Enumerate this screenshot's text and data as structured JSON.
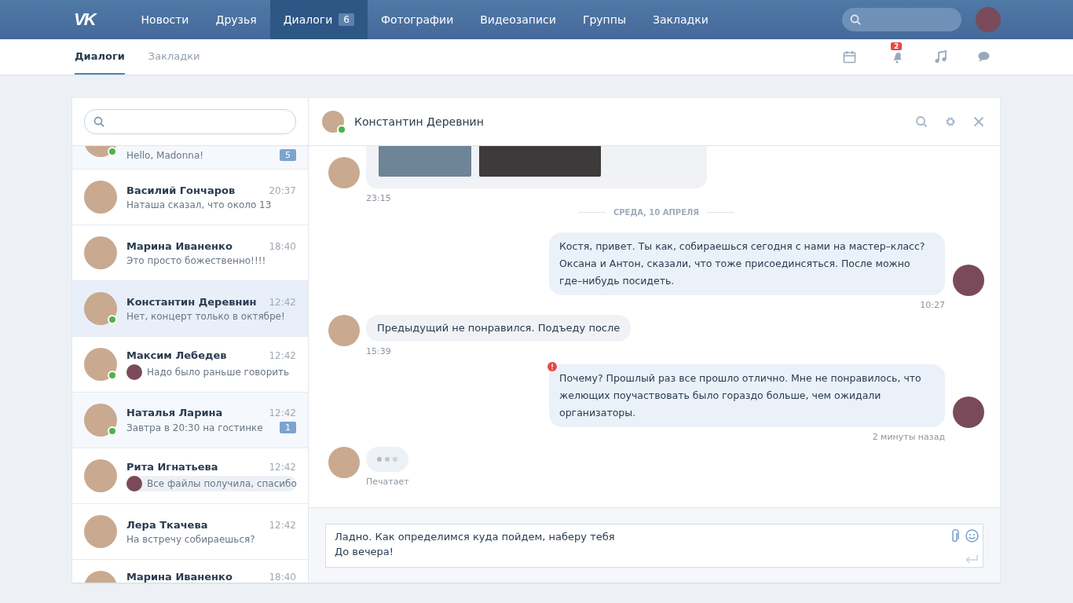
{
  "topbar": {
    "logo": "VK",
    "nav": [
      {
        "label": "Новости",
        "selected": false
      },
      {
        "label": "Друзья",
        "selected": false
      },
      {
        "label": "Диалоги",
        "selected": true,
        "badge": "6"
      },
      {
        "label": "Фотографии",
        "selected": false
      },
      {
        "label": "Видеозаписи",
        "selected": false
      },
      {
        "label": "Группы",
        "selected": false
      },
      {
        "label": "Закладки",
        "selected": false
      }
    ]
  },
  "subnav": {
    "tabs": [
      {
        "label": "Диалоги",
        "selected": true
      },
      {
        "label": "Закладки",
        "selected": false
      }
    ],
    "notifications_badge": "2"
  },
  "dialogs": [
    {
      "preview": "Hello, Madonna!",
      "online": true,
      "badge": "5",
      "selected": false
    },
    {
      "name": "Василий Гончаров",
      "time": "20:37",
      "preview": "Наташа сказал, что около 13",
      "online": false,
      "selected": false
    },
    {
      "name": "Марина Иваненко",
      "time": "18:40",
      "preview": "Это просто божественно!!!!",
      "online": false,
      "selected": false
    },
    {
      "name": "Константин Деревнин",
      "time": "12:42",
      "preview": "Нет, концерт только в октябре!",
      "online": true,
      "selected": true
    },
    {
      "name": "Максим Лебедев",
      "time": "12:42",
      "preview": "Надо было раньше говорить",
      "online": true,
      "selected": false,
      "outgoing": true,
      "read": true
    },
    {
      "name": "Наталья Ларина",
      "time": "12:42",
      "preview": "Завтра в 20:30 на гостинке",
      "online": true,
      "badge": "1",
      "selected": false
    },
    {
      "name": "Рита Игнатьева",
      "time": "12:42",
      "preview": "Все файлы получила, спасибо",
      "online": false,
      "selected": false,
      "outgoing": true,
      "read": false
    },
    {
      "name": "Лера Ткачева",
      "time": "12:42",
      "preview": "На встречу собираешься?",
      "online": false,
      "selected": false
    },
    {
      "name": "Марина Иваненко",
      "time": "18:40",
      "selected": false
    }
  ],
  "chat": {
    "title": "Константин Деревнин",
    "online": true,
    "messages": [
      {
        "kind": "photos",
        "time": "23:15"
      },
      {
        "kind": "date",
        "text": "СРЕДА, 10 АПРЕЛЯ"
      },
      {
        "kind": "outgoing",
        "text": "Костя, привет. Ты как, собираешься сегодня с нами на мастер–класс? Оксана и Антон, сказали, что тоже присоединсяться. После можно где–нибудь посидеть.",
        "time": "10:27",
        "error": false
      },
      {
        "kind": "incoming",
        "text": "Предыдущий не понравился. Подъеду после",
        "time": "15:39"
      },
      {
        "kind": "outgoing",
        "text": "Почему? Прошлый раз все прошло отлично. Мне не понравилось, что желющих поучаствовать было гораздо больше, чем ожидали организаторы.",
        "time": "2 минуты назад",
        "error": true
      },
      {
        "kind": "typing",
        "time": "Печатает"
      }
    ],
    "composer": {
      "value": "Ладно. Как определимся куда пойдем, наберу тебя\nДо вечера!"
    }
  }
}
